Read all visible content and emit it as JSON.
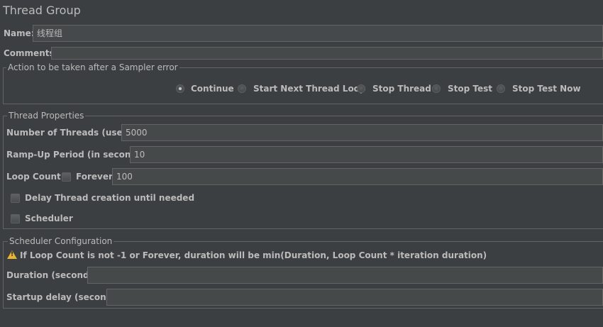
{
  "panel_title": "Thread Group",
  "name": {
    "label": "Name:",
    "value": "线程组"
  },
  "comments": {
    "label": "Comments:",
    "value": ""
  },
  "sampler_error": {
    "legend": "Action to be taken after a Sampler error",
    "options": [
      "Continue",
      "Start Next Thread Loop",
      "Stop Thread",
      "Stop Test",
      "Stop Test Now"
    ],
    "selected": "Continue"
  },
  "thread_properties": {
    "legend": "Thread Properties",
    "threads_label": "Number of Threads (users):",
    "threads_value": "5000",
    "rampup_label": "Ramp-Up Period (in seconds):",
    "rampup_value": "10",
    "loop_label": "Loop Count:",
    "forever_label": "Forever",
    "forever_checked": false,
    "loop_value": "100",
    "delay_label": "Delay Thread creation until needed",
    "delay_checked": false,
    "scheduler_label": "Scheduler",
    "scheduler_checked": false
  },
  "scheduler_config": {
    "legend": "Scheduler Configuration",
    "warning": "If Loop Count is not -1 or Forever, duration will be min(Duration, Loop Count * iteration duration)",
    "duration_label": "Duration (seconds)",
    "duration_value": "",
    "startup_label": "Startup delay (seconds)",
    "startup_value": ""
  },
  "colors": {
    "background": "#3c3f41",
    "field": "#45494a",
    "border": "#646464",
    "text": "#bbbbbb",
    "warning": "#e8b436"
  },
  "icons": {
    "warning": "warning-triangle-icon"
  }
}
